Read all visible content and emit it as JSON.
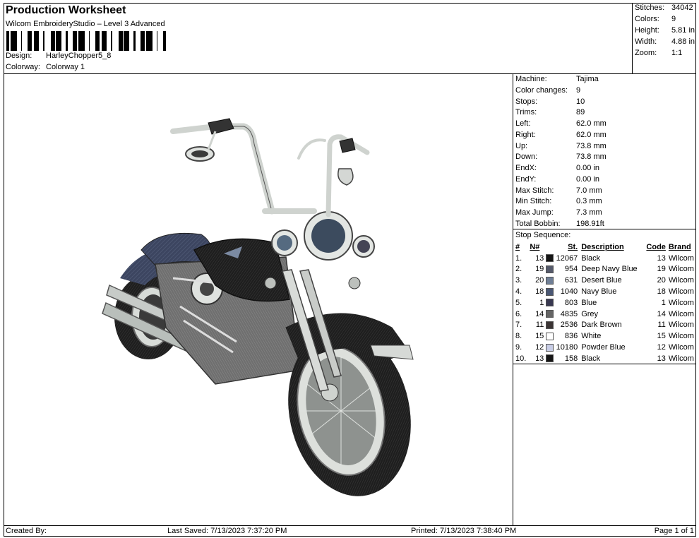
{
  "header": {
    "title": "Production Worksheet",
    "software": "Wilcom EmbroideryStudio – Level 3 Advanced",
    "design_label": "Design:",
    "design_value": "HarleyChopper5_8",
    "colorway_label": "Colorway:",
    "colorway_value": "Colorway 1"
  },
  "summary": [
    {
      "label": "Stitches:",
      "value": "34042"
    },
    {
      "label": "Colors:",
      "value": "9"
    },
    {
      "label": "Height:",
      "value": "5.81 in"
    },
    {
      "label": "Width:",
      "value": "4.88 in"
    },
    {
      "label": "Zoom:",
      "value": "1:1"
    }
  ],
  "machine_info": [
    {
      "label": "Machine:",
      "value": "Tajima"
    },
    {
      "label": "Color changes:",
      "value": "9"
    },
    {
      "label": "Stops:",
      "value": "10"
    },
    {
      "label": "Trims:",
      "value": "89"
    },
    {
      "label": "Left:",
      "value": "62.0 mm"
    },
    {
      "label": "Right:",
      "value": "62.0 mm"
    },
    {
      "label": "Up:",
      "value": "73.8 mm"
    },
    {
      "label": "Down:",
      "value": "73.8 mm"
    },
    {
      "label": "EndX:",
      "value": "0.00 in"
    },
    {
      "label": "EndY:",
      "value": "0.00 in"
    },
    {
      "label": "Max Stitch:",
      "value": "7.0 mm"
    },
    {
      "label": "Min Stitch:",
      "value": "0.3 mm"
    },
    {
      "label": "Max Jump:",
      "value": "7.3 mm"
    },
    {
      "label": "Total Bobbin:",
      "value": "198.91ft"
    }
  ],
  "stop_sequence": {
    "caption": "Stop Sequence:",
    "headers": [
      "#",
      "N#",
      "St.",
      "Description",
      "Code",
      "Brand"
    ],
    "rows": [
      {
        "idx": "1.",
        "n": "13",
        "color": "#151515",
        "st": "12067",
        "desc": "Black",
        "code": "13",
        "brand": "Wilcom"
      },
      {
        "idx": "2.",
        "n": "19",
        "color": "#555a6b",
        "st": "954",
        "desc": "Deep Navy Blue",
        "code": "19",
        "brand": "Wilcom"
      },
      {
        "idx": "3.",
        "n": "20",
        "color": "#6f7f96",
        "st": "631",
        "desc": "Desert Blue",
        "code": "20",
        "brand": "Wilcom"
      },
      {
        "idx": "4.",
        "n": "18",
        "color": "#4a5774",
        "st": "1040",
        "desc": "Navy Blue",
        "code": "18",
        "brand": "Wilcom"
      },
      {
        "idx": "5.",
        "n": "1",
        "color": "#383850",
        "st": "803",
        "desc": "Blue",
        "code": "1",
        "brand": "Wilcom"
      },
      {
        "idx": "6.",
        "n": "14",
        "color": "#656565",
        "st": "4835",
        "desc": "Grey",
        "code": "14",
        "brand": "Wilcom"
      },
      {
        "idx": "7.",
        "n": "11",
        "color": "#3b3434",
        "st": "2536",
        "desc": "Dark Brown",
        "code": "11",
        "brand": "Wilcom"
      },
      {
        "idx": "8.",
        "n": "15",
        "color": "#ffffff",
        "st": "836",
        "desc": "White",
        "code": "15",
        "brand": "Wilcom"
      },
      {
        "idx": "9.",
        "n": "12",
        "color": "#c8cde6",
        "st": "10180",
        "desc": "Powder Blue",
        "code": "12",
        "brand": "Wilcom"
      },
      {
        "idx": "10.",
        "n": "13",
        "color": "#151515",
        "st": "158",
        "desc": "Black",
        "code": "13",
        "brand": "Wilcom"
      }
    ]
  },
  "footer": {
    "created_by": "Created By:",
    "last_saved": "Last Saved: 7/13/2023 7:37:20 PM",
    "printed": "Printed: 7/13/2023 7:38:40 PM",
    "page": "Page 1 of 1"
  }
}
